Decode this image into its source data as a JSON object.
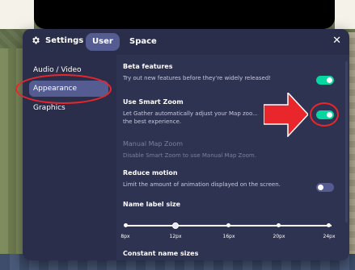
{
  "header": {
    "title": "Settings",
    "tabs": [
      {
        "label": "User",
        "active": true
      },
      {
        "label": "Space",
        "active": false
      }
    ],
    "close_label": "✕"
  },
  "sidebar": {
    "items": [
      {
        "label": "Audio / Video",
        "active": false
      },
      {
        "label": "Appearance",
        "active": true
      },
      {
        "label": "Graphics",
        "active": false
      }
    ]
  },
  "settings": {
    "beta": {
      "title": "Beta features",
      "description": "Try out new features before they're widely released!",
      "enabled": true
    },
    "smart_zoom": {
      "title": "Use Smart Zoom",
      "description": "Let Gather automatically adjust your Map zoo... the best experience.",
      "enabled": true
    },
    "manual_zoom": {
      "title": "Manual Map Zoom",
      "description": "Disable Smart Zoom to use Manual Map Zoom.",
      "disabled": true
    },
    "reduce_motion": {
      "title": "Reduce motion",
      "description": "Limit the amount of animation displayed on the screen.",
      "enabled": false
    },
    "name_label_size": {
      "title": "Name label size",
      "options": [
        "8px",
        "12px",
        "16px",
        "20px",
        "24px"
      ],
      "selected": "12px"
    },
    "constant_name_sizes": {
      "title": "Constant name sizes"
    }
  },
  "colors": {
    "dialog_bg": "#2b2e4a",
    "accent": "#545c91",
    "toggle_on": "#06d6a0",
    "annotation": "#e8262b"
  },
  "icons": {
    "settings": "gear-icon",
    "close": "close-icon"
  }
}
